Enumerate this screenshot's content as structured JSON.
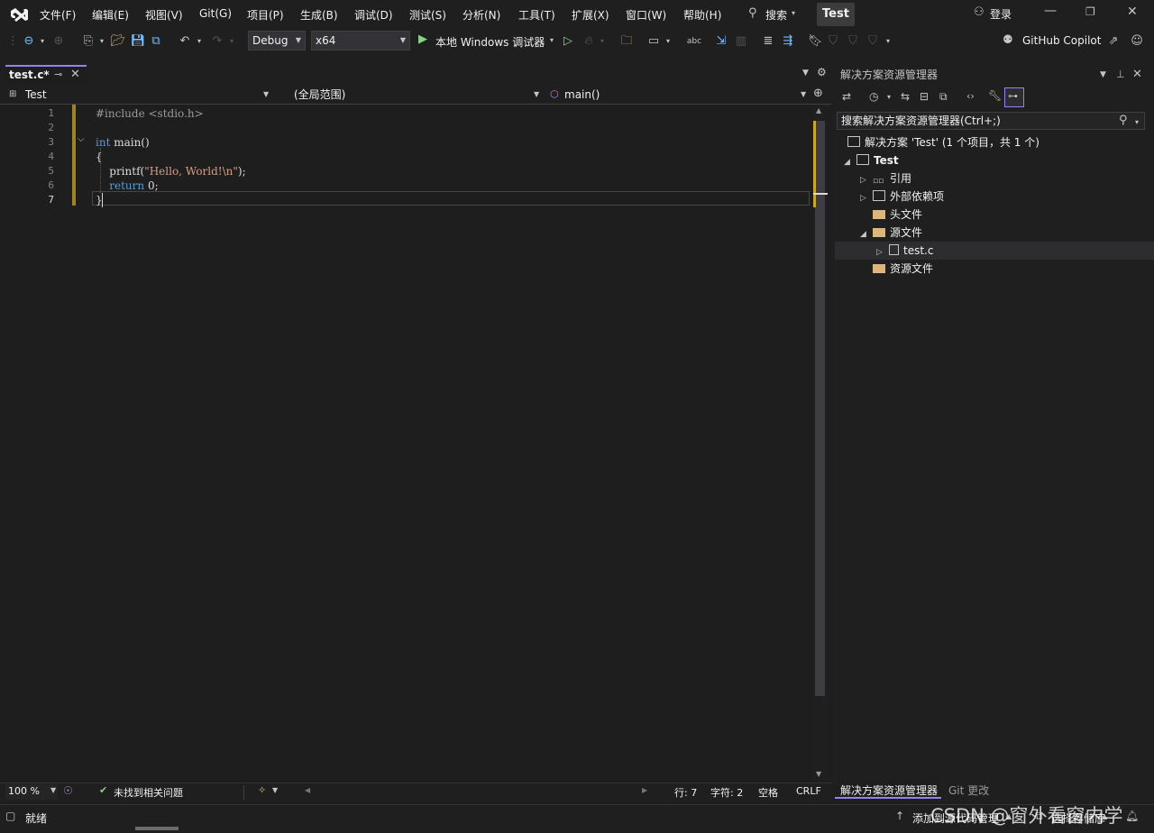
{
  "menu": {
    "items": [
      "文件(F)",
      "编辑(E)",
      "视图(V)",
      "Git(G)",
      "项目(P)",
      "生成(B)",
      "调试(D)",
      "测试(S)",
      "分析(N)",
      "工具(T)",
      "扩展(X)",
      "窗口(W)",
      "帮助(H)"
    ],
    "search_label": "搜索",
    "project_badge": "Test",
    "login_label": "登录"
  },
  "toolbar": {
    "config": "Debug",
    "platform": "x64",
    "run_label": "本地 Windows 调试器",
    "copilot_label": "GitHub Copilot"
  },
  "editor": {
    "tab_title": "test.c*",
    "nav_project": "Test",
    "nav_scope": "(全局范围)",
    "nav_member": "main()",
    "lines": [
      {
        "num": "1",
        "text": "#include <stdio.h>"
      },
      {
        "num": "2",
        "text": ""
      },
      {
        "num": "3",
        "text": "int main()"
      },
      {
        "num": "4",
        "text": "{"
      },
      {
        "num": "5",
        "text": "    printf(\"Hello, World!\\n\");"
      },
      {
        "num": "6",
        "text": "    return 0;"
      },
      {
        "num": "7",
        "text": "}"
      }
    ],
    "zoom": "100 %",
    "issues": "未找到相关问题",
    "line_pos": "行: 7",
    "col_pos": "字符: 2",
    "indent": "空格",
    "eol": "CRLF"
  },
  "solution_explorer": {
    "title": "解决方案资源管理器",
    "search_placeholder": "搜索解决方案资源管理器(Ctrl+;)",
    "solution_label": "解决方案 'Test' (1 个项目，共 1 个)",
    "project": "Test",
    "nodes": [
      "引用",
      "外部依赖项",
      "头文件",
      "源文件",
      "test.c",
      "资源文件"
    ],
    "bottom_tabs": [
      "解决方案资源管理器",
      "Git 更改"
    ]
  },
  "status": {
    "ready": "就绪",
    "source_control": "添加到源代码管理",
    "repo": "选择存储库"
  },
  "watermark": "CSDN @窗外看窗内学"
}
